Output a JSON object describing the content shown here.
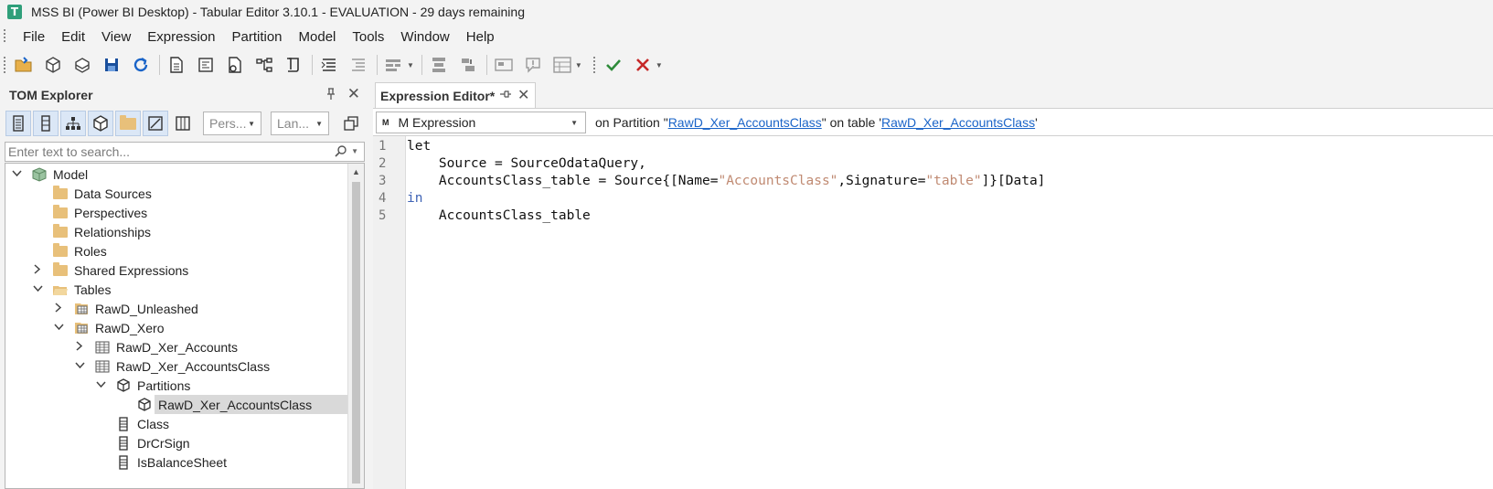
{
  "window": {
    "title": "MSS BI (Power BI Desktop) - Tabular Editor 3.10.1 - EVALUATION - 29 days remaining",
    "app_icon": "T"
  },
  "menu": {
    "items": [
      {
        "label": "File"
      },
      {
        "label": "Edit"
      },
      {
        "label": "View"
      },
      {
        "label": "Expression"
      },
      {
        "label": "Partition"
      },
      {
        "label": "Model"
      },
      {
        "label": "Tools"
      },
      {
        "label": "Window"
      },
      {
        "label": "Help"
      }
    ]
  },
  "toolbar": {
    "icons": [
      "open-folder-icon",
      "new-model-icon",
      "deploy-icon",
      "save-icon",
      "refresh-icon",
      "new-document-icon",
      "new-dax-query-icon",
      "new-pivot-icon",
      "new-diagram-icon",
      "new-script-icon",
      "format-icon",
      "comment-icon",
      "align-icon",
      "split-icon",
      "move-icon",
      "preview-icon",
      "tooltip-icon",
      "grid-icon",
      "apply-icon",
      "cancel-icon"
    ],
    "colors": {
      "apply": "#2e8b3a",
      "cancel": "#c62828",
      "accent": "#1a64c8"
    }
  },
  "tom_explorer": {
    "title": "TOM Explorer",
    "perspective_placeholder": "Pers...",
    "language_placeholder": "Lan...",
    "search_placeholder": "Enter text to search...",
    "tree": [
      {
        "label": "Model",
        "level": 0,
        "expander": "expanded",
        "icon": "model-icon"
      },
      {
        "label": "Data Sources",
        "level": 1,
        "expander": "none",
        "icon": "folder-icon"
      },
      {
        "label": "Perspectives",
        "level": 1,
        "expander": "none",
        "icon": "folder-icon"
      },
      {
        "label": "Relationships",
        "level": 1,
        "expander": "none",
        "icon": "folder-icon"
      },
      {
        "label": "Roles",
        "level": 1,
        "expander": "none",
        "icon": "folder-icon"
      },
      {
        "label": "Shared Expressions",
        "level": 1,
        "expander": "collapsed",
        "icon": "folder-icon"
      },
      {
        "label": "Tables",
        "level": 1,
        "expander": "expanded",
        "icon": "open-folder-icon"
      },
      {
        "label": "RawD_Unleashed",
        "level": 2,
        "expander": "collapsed",
        "icon": "table-group-icon"
      },
      {
        "label": "RawD_Xero",
        "level": 2,
        "expander": "expanded",
        "icon": "table-group-icon"
      },
      {
        "label": "RawD_Xer_Accounts",
        "level": 3,
        "expander": "collapsed",
        "icon": "table-icon"
      },
      {
        "label": "RawD_Xer_AccountsClass",
        "level": 3,
        "expander": "expanded",
        "icon": "table-icon"
      },
      {
        "label": "Partitions",
        "level": 4,
        "expander": "expanded",
        "icon": "partitions-icon"
      },
      {
        "label": "RawD_Xer_AccountsClass",
        "level": 5,
        "expander": "none",
        "icon": "partition-icon",
        "selected": true
      },
      {
        "label": "Class",
        "level": 4,
        "expander": "none",
        "icon": "column-icon"
      },
      {
        "label": "DrCrSign",
        "level": 4,
        "expander": "none",
        "icon": "column-icon"
      },
      {
        "label": "IsBalanceSheet",
        "level": 4,
        "expander": "none",
        "icon": "column-icon"
      }
    ]
  },
  "expression_editor": {
    "tab_title": "Expression Editor*",
    "expression_type": "M Expression",
    "info_prefix": "on Partition \"",
    "partition_link": "RawD_Xer_AccountsClass",
    "info_middle": "\" on table '",
    "table_link": "RawD_Xer_AccountsClass",
    "info_suffix": "'",
    "line_numbers": [
      "1",
      "2",
      "3",
      "4",
      "5"
    ],
    "code": {
      "l1_kw": "let",
      "l2": "    Source = SourceOdataQuery,",
      "l3_a": "    AccountsClass_table = Source{[Name=",
      "l3_s1": "\"AccountsClass\"",
      "l3_b": ",Signature=",
      "l3_s2": "\"table\"",
      "l3_c": "]}[Data]",
      "l4_kw": "in",
      "l5": "    AccountsClass_table"
    }
  }
}
